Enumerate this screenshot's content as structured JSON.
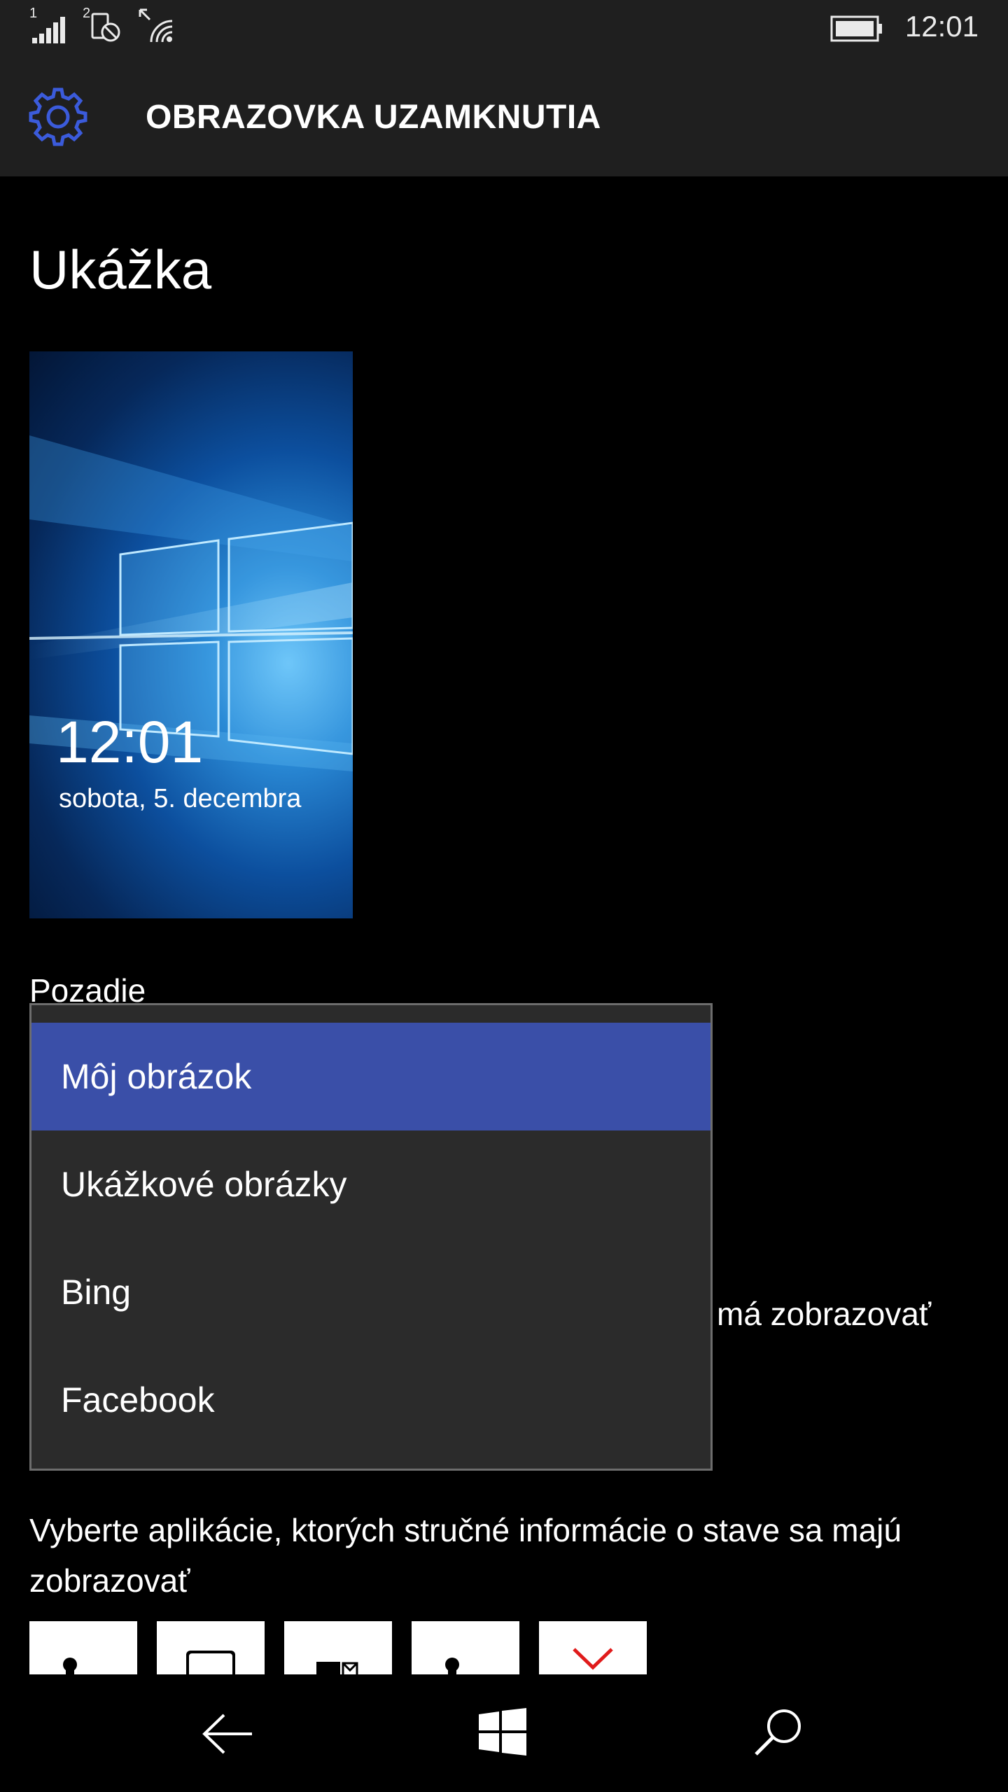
{
  "status_bar": {
    "sim1": "1",
    "sim2": "2",
    "time": "12:01"
  },
  "header": {
    "title": "OBRAZOVKA UZAMKNUTIA",
    "icon": "gear-icon",
    "accent": "#3b5bdb"
  },
  "preview": {
    "section_title": "Ukážka",
    "time": "12:01",
    "date": "sobota, 5. decembra"
  },
  "background": {
    "label": "Pozadie",
    "options": [
      "Môj obrázok",
      "Ukážkové obrázky",
      "Bing",
      "Facebook"
    ],
    "selected": "Môj obrázok",
    "selected_color": "#3a4fa8"
  },
  "partial_text": "má zobrazovať",
  "apps": {
    "prompt": "Vyberte aplikácie, ktorých stručné informácie o stave sa majú zobrazovať",
    "tiles": [
      "contact-icon",
      "message-icon",
      "outlook-icon",
      "contact-icon",
      "chevron-down-icon"
    ]
  },
  "nav": {
    "back": "back-arrow-icon",
    "home": "windows-logo-icon",
    "search": "search-icon"
  }
}
